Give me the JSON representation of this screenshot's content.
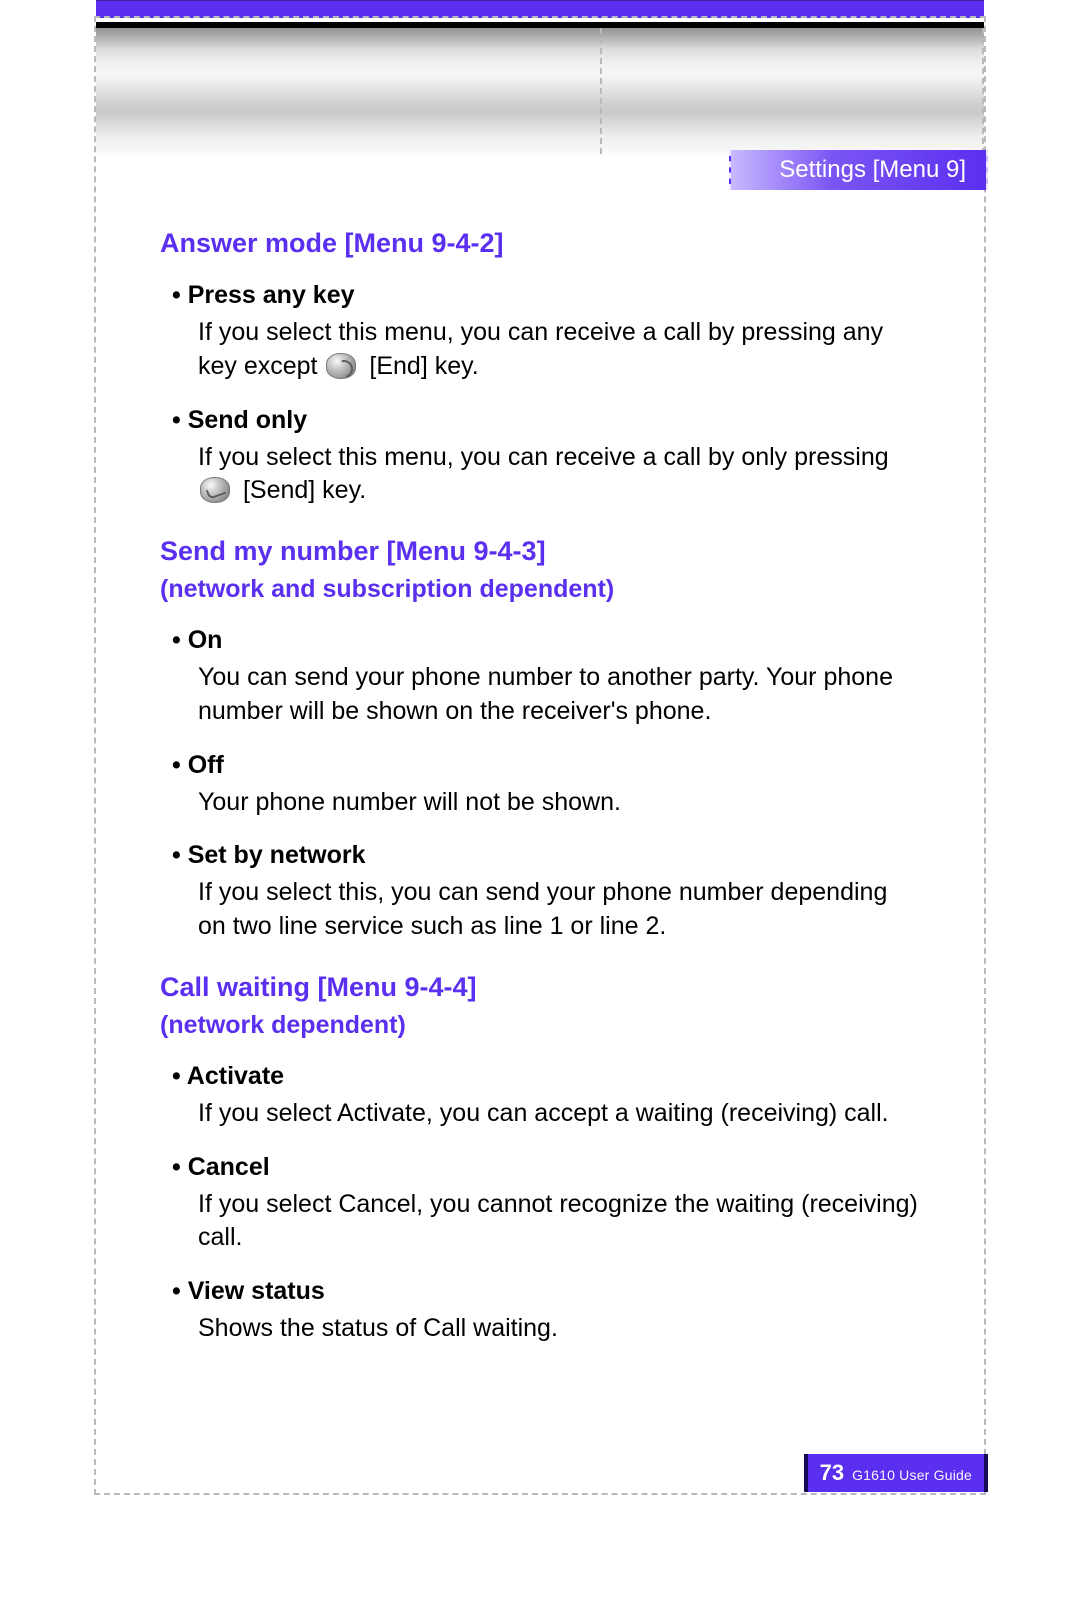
{
  "header": {
    "breadcrumb": "Settings [Menu 9]"
  },
  "sections": {
    "answer_mode": {
      "title": "Answer mode [Menu 9-4-2]",
      "press_any_key": {
        "label": "Press any key",
        "text_before_icon": "If you select this menu, you can receive a call by pressing any key except ",
        "text_after_icon": " [End] key."
      },
      "send_only": {
        "label": "Send only",
        "text_before_icon": "If you select this menu, you can receive a call by only pressing ",
        "text_after_icon": " [Send] key."
      }
    },
    "send_my_number": {
      "title": "Send my number [Menu 9-4-3]",
      "subtitle": "(network and subscription dependent)",
      "on": {
        "label": "On",
        "text": "You can send your phone number to another party. Your phone number will be shown on the receiver's phone."
      },
      "off": {
        "label": "Off",
        "text": "Your phone number will not be shown."
      },
      "set_by_network": {
        "label": "Set by network",
        "text": "If you select this, you can send your phone number depending on two line service such as line 1 or line 2."
      }
    },
    "call_waiting": {
      "title": "Call waiting [Menu 9-4-4]",
      "subtitle": "(network dependent)",
      "activate": {
        "label": "Activate",
        "text": "If you select Activate, you can accept a waiting (receiving) call."
      },
      "cancel": {
        "label": "Cancel",
        "text": "If you select Cancel, you cannot recognize the waiting (receiving) call."
      },
      "view_status": {
        "label": "View status",
        "text": "Shows the status of Call waiting."
      }
    }
  },
  "footer": {
    "page_number": "73",
    "guide_name": "G1610 User Guide"
  }
}
